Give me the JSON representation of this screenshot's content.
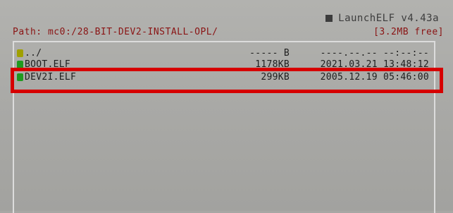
{
  "header": {
    "app_title": "LaunchELF v4.43a"
  },
  "path_bar": {
    "path": "Path: mc0:/28-BIT-DEV2-INSTALL-OPL/",
    "free_space": "[3.2MB free]"
  },
  "files": [
    {
      "icon": "folder-icon",
      "name": "../",
      "size": "----- B",
      "date": "----.--.-- --:--:--"
    },
    {
      "icon": "file-icon",
      "name": "BOOT.ELF",
      "size": "1178KB",
      "date": "2021.03.21 13:48:12"
    },
    {
      "icon": "file-icon",
      "name": "DEV2I.ELF",
      "size": "299KB",
      "date": "2005.12.19 05:46:00"
    }
  ],
  "colors": {
    "path_text": "#8a1414",
    "folder_icon": "#a0a000",
    "file_icon": "#1f9a1f",
    "highlight_border": "#d60000"
  }
}
